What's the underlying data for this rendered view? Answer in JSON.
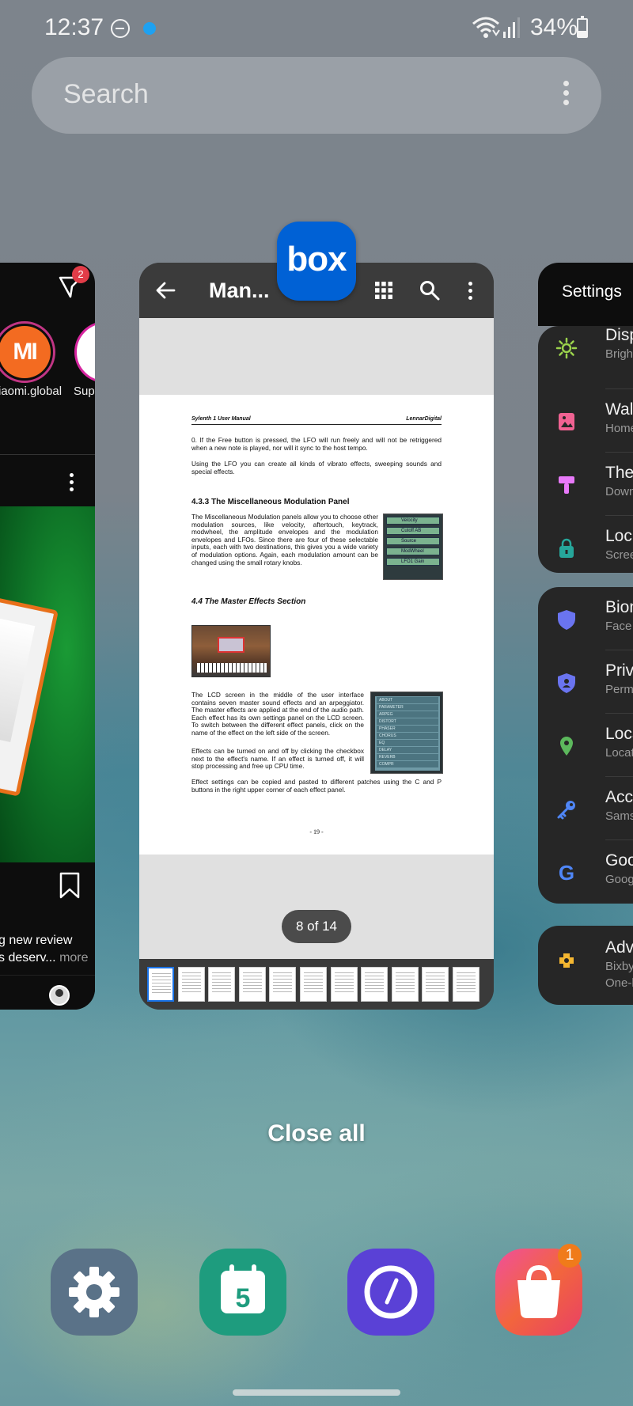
{
  "status_bar": {
    "time": "12:37",
    "battery": "34%",
    "battery_level": 0.34
  },
  "search": {
    "placeholder": "Search"
  },
  "left_card": {
    "filter_badge": "2",
    "stories": [
      "iaomi.global",
      "Supp"
    ],
    "avatar_text": "MI",
    "caption_line1": "g new review",
    "caption_line2": "s deserv...",
    "caption_more": "more"
  },
  "center_card": {
    "app": "box",
    "toolbar_title": "Man...",
    "page_indicator": "8 of 14",
    "thumbnail_count": 11,
    "document": {
      "header_left": "Sylenth 1 User Manual",
      "header_right": "LennarDigital",
      "p1": "0. If the Free button is pressed, the LFO will run freely and will not be retriggered when a new note is played, nor will it sync to the host tempo.",
      "p2": "Using the LFO you can create all kinds of vibrato effects, sweeping sounds and special effects.",
      "h1": "4.3.3 The Miscellaneous Modulation Panel",
      "p3": "The Miscellaneous Modulation panels allow you to choose other modulation sources, like velocity, aftertouch, keytrack, modwheel, the amplitude envelopes and the modulation envelopes and LFOs. Since there are four of these selectable inputs, each with two destinations, this gives you a wide variety of modulation options. Again, each modulation amount can be changed using the small rotary knobs.",
      "h2": "4.4 The Master Effects Section",
      "p4": "The LCD screen in the middle of the user interface contains seven master sound effects and an arpeggiator. The master effects are applied at the end of the audio path. Each effect has its own settings panel on the LCD screen. To switch between the different effect panels, click on the name of the effect on the left side of the screen.",
      "p5": "Effects can be turned on and off by clicking the checkbox next to the effect's name. If an effect is turned off, it will stop processing and free up CPU time.",
      "p6": "Effect settings can be copied and pasted to different patches using the C and P buttons in the right upper corner of each effect panel.",
      "page_number": "- 19 -",
      "mod_rows": [
        "Velocity",
        "Cutoff AB",
        "Source",
        "ModWheel",
        "LFO1 Gain"
      ],
      "lcd_rows": [
        "ABOUT",
        "PARAMETER",
        "ARPEG",
        "DISTORT",
        "PHASER",
        "CHORUS",
        "EQ",
        "DELAY",
        "REVERB",
        "COMPR"
      ]
    }
  },
  "right_card": {
    "title": "Settings",
    "items": [
      {
        "title": "Disp",
        "sub": "Brigh",
        "icon": "sun-icon",
        "color": "#9bd34c"
      },
      {
        "title": "Wall",
        "sub": "Home",
        "icon": "wallpaper-icon",
        "color": "#f06292"
      },
      {
        "title": "The",
        "sub": "Down",
        "icon": "brush-icon",
        "color": "#e879f9"
      },
      {
        "title": "Lock",
        "sub": "Scree",
        "icon": "lock-icon",
        "color": "#26a69a"
      },
      {
        "title": "Bion",
        "sub": "Face",
        "icon": "shield-icon",
        "color": "#6a74f0"
      },
      {
        "title": "Priv",
        "sub": "Perm",
        "icon": "privacy-icon",
        "color": "#6a74f0"
      },
      {
        "title": "Loca",
        "sub": "Locat",
        "icon": "location-icon",
        "color": "#5cb85c"
      },
      {
        "title": "Acc",
        "sub": "Sams",
        "icon": "key-icon",
        "color": "#4f86f7"
      },
      {
        "title": "Goo",
        "sub": "Goog",
        "icon": "google-icon",
        "color": "#4f86f7"
      },
      {
        "title": "Adv",
        "sub": "Bixby",
        "sub2": "One-h",
        "icon": "advanced-icon",
        "color": "#f5b731"
      }
    ]
  },
  "close_all": "Close all",
  "dock": {
    "calendar_day": "5",
    "store_badge": "1"
  }
}
